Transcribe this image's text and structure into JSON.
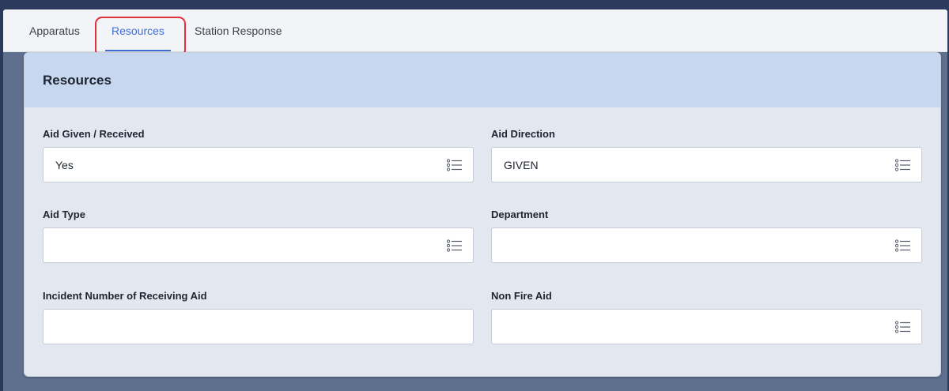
{
  "tabs": [
    {
      "label": "Apparatus",
      "active": false
    },
    {
      "label": "Resources",
      "active": true
    },
    {
      "label": "Station Response",
      "active": false
    }
  ],
  "section": {
    "title": "Resources"
  },
  "fields": {
    "aid_given_received": {
      "label": "Aid Given / Received",
      "value": "Yes",
      "has_list_icon": true
    },
    "aid_direction": {
      "label": "Aid Direction",
      "value": "GIVEN",
      "has_list_icon": true
    },
    "aid_type": {
      "label": "Aid Type",
      "value": "",
      "has_list_icon": true
    },
    "department": {
      "label": "Department",
      "value": "",
      "has_list_icon": true
    },
    "incident_number": {
      "label": "Incident Number of Receiving Aid",
      "value": "",
      "has_list_icon": false
    },
    "non_fire_aid": {
      "label": "Non Fire Aid",
      "value": "",
      "has_list_icon": true
    }
  },
  "icons": {
    "list": "list-icon"
  },
  "colors": {
    "accent": "#3d6fd6",
    "highlight": "#e0303d",
    "header_bg": "#c6d7ef",
    "card_bg": "#e3e8f0"
  }
}
